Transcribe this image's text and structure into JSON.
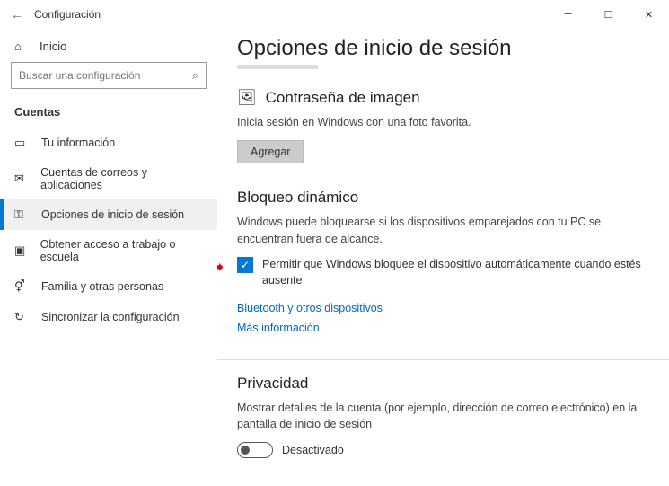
{
  "window": {
    "title": "Configuración"
  },
  "sidebar": {
    "home_label": "Inicio",
    "search_placeholder": "Buscar una configuración",
    "section_title": "Cuentas",
    "items": [
      {
        "label": "Tu información",
        "icon": "user-card-icon"
      },
      {
        "label": "Cuentas de correos y aplicaciones",
        "icon": "mail-icon"
      },
      {
        "label": "Opciones de inicio de sesión",
        "icon": "key-icon"
      },
      {
        "label": "Obtener acceso a trabajo o escuela",
        "icon": "briefcase-icon"
      },
      {
        "label": "Familia y otras personas",
        "icon": "people-icon"
      },
      {
        "label": "Sincronizar la configuración",
        "icon": "sync-icon"
      }
    ]
  },
  "main": {
    "page_title": "Opciones de inicio de sesión",
    "picture_password": {
      "title": "Contraseña de imagen",
      "desc": "Inicia sesión en Windows con una foto favorita.",
      "button": "Agregar"
    },
    "dynamic_lock": {
      "title": "Bloqueo dinámico",
      "desc": "Windows puede bloquearse si los dispositivos emparejados con tu PC se encuentran fuera de alcance.",
      "checkbox_label": "Permitir que Windows bloquee el dispositivo automáticamente cuando estés ausente",
      "checkbox_checked": true,
      "link_bluetooth": "Bluetooth y otros dispositivos",
      "link_more": "Más información"
    },
    "privacy": {
      "title": "Privacidad",
      "desc": "Mostrar detalles de la cuenta (por ejemplo, dirección de correo electrónico) en la pantalla de inicio de sesión",
      "toggle_state": "Desactivado",
      "toggle_on": false
    }
  }
}
